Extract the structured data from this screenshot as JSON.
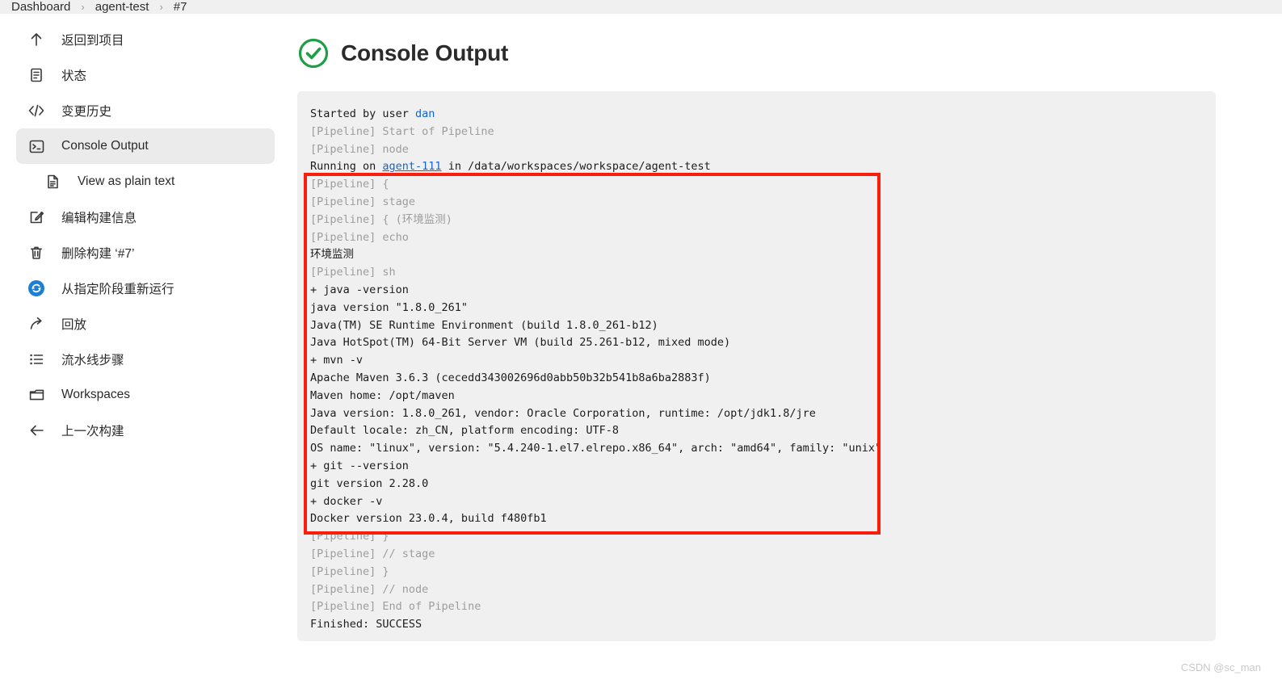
{
  "breadcrumb": {
    "items": [
      "Dashboard",
      "agent-test",
      "#7"
    ],
    "separator": "›"
  },
  "sidebar": {
    "items": [
      {
        "label": "返回到项目",
        "icon": "arrow-up-icon",
        "selected": false,
        "child": false
      },
      {
        "label": "状态",
        "icon": "status-document-icon",
        "selected": false,
        "child": false
      },
      {
        "label": "变更历史",
        "icon": "code-brackets-icon",
        "selected": false,
        "child": false
      },
      {
        "label": "Console Output",
        "icon": "terminal-icon",
        "selected": true,
        "child": false
      },
      {
        "label": "View as plain text",
        "icon": "plain-text-file-icon",
        "selected": false,
        "child": true
      },
      {
        "label": "编辑构建信息",
        "icon": "edit-pencil-icon",
        "selected": false,
        "child": false
      },
      {
        "label": "删除构建 ‘#7’",
        "icon": "trash-icon",
        "selected": false,
        "child": false
      },
      {
        "label": "从指定阶段重新运行",
        "icon": "restart-circle-icon",
        "selected": false,
        "child": false
      },
      {
        "label": "回放",
        "icon": "replay-arrow-icon",
        "selected": false,
        "child": false
      },
      {
        "label": "流水线步骤",
        "icon": "pipeline-steps-icon",
        "selected": false,
        "child": false
      },
      {
        "label": "Workspaces",
        "icon": "folder-icon",
        "selected": false,
        "child": false
      },
      {
        "label": "上一次构建",
        "icon": "arrow-left-icon",
        "selected": false,
        "child": false
      }
    ]
  },
  "header": {
    "title": "Console Output",
    "status_icon": "success-check-circle-icon",
    "status_color": "#1f9d47"
  },
  "console": {
    "lines": [
      {
        "text": "Started by user ",
        "style": "normal",
        "link": "dan",
        "link_style": "plain"
      },
      {
        "text": "[Pipeline] Start of Pipeline",
        "style": "dim"
      },
      {
        "text": "[Pipeline] node",
        "style": "dim"
      },
      {
        "text": "Running on ",
        "style": "normal",
        "link": "agent-111",
        "link_style": "underline",
        "tail": " in /data/workspaces/workspace/agent-test"
      },
      {
        "text": "[Pipeline] {",
        "style": "dim"
      },
      {
        "text": "[Pipeline] stage",
        "style": "dim"
      },
      {
        "text": "[Pipeline] { (环境监测)",
        "style": "dim"
      },
      {
        "text": "[Pipeline] echo",
        "style": "dim"
      },
      {
        "text": "环境监测",
        "style": "normal"
      },
      {
        "text": "[Pipeline] sh",
        "style": "dim"
      },
      {
        "text": "+ java -version",
        "style": "normal"
      },
      {
        "text": "java version \"1.8.0_261\"",
        "style": "normal"
      },
      {
        "text": "Java(TM) SE Runtime Environment (build 1.8.0_261-b12)",
        "style": "normal"
      },
      {
        "text": "Java HotSpot(TM) 64-Bit Server VM (build 25.261-b12, mixed mode)",
        "style": "normal"
      },
      {
        "text": "+ mvn -v",
        "style": "normal"
      },
      {
        "text": "Apache Maven 3.6.3 (cecedd343002696d0abb50b32b541b8a6ba2883f)",
        "style": "normal"
      },
      {
        "text": "Maven home: /opt/maven",
        "style": "normal"
      },
      {
        "text": "Java version: 1.8.0_261, vendor: Oracle Corporation, runtime: /opt/jdk1.8/jre",
        "style": "normal"
      },
      {
        "text": "Default locale: zh_CN, platform encoding: UTF-8",
        "style": "normal"
      },
      {
        "text": "OS name: \"linux\", version: \"5.4.240-1.el7.elrepo.x86_64\", arch: \"amd64\", family: \"unix\"",
        "style": "normal"
      },
      {
        "text": "+ git --version",
        "style": "normal"
      },
      {
        "text": "git version 2.28.0",
        "style": "normal"
      },
      {
        "text": "+ docker -v",
        "style": "normal"
      },
      {
        "text": "Docker version 23.0.4, build f480fb1",
        "style": "normal"
      },
      {
        "text": "[Pipeline] }",
        "style": "dim"
      },
      {
        "text": "[Pipeline] // stage",
        "style": "dim"
      },
      {
        "text": "[Pipeline] }",
        "style": "dim"
      },
      {
        "text": "[Pipeline] // node",
        "style": "dim"
      },
      {
        "text": "[Pipeline] End of Pipeline",
        "style": "dim"
      },
      {
        "text": "Finished: SUCCESS",
        "style": "normal"
      }
    ]
  },
  "annotation": {
    "box_color": "#f91e0c"
  },
  "watermark": {
    "text": "CSDN @sc_man"
  }
}
